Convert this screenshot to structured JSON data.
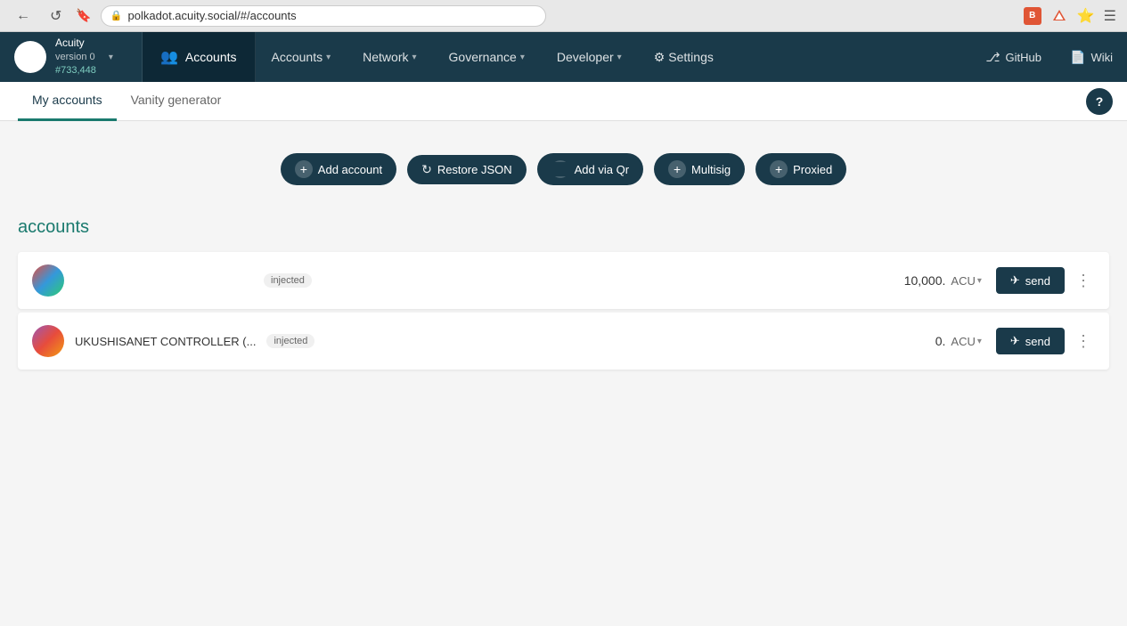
{
  "browser": {
    "url": "polkadot.acuity.social/#/accounts",
    "back_btn": "←",
    "reload_btn": "↺",
    "bookmark_icon": "🔖",
    "lock_icon": "🔒"
  },
  "app": {
    "logo": {
      "name": "Acuity",
      "version": "version 0",
      "block": "#733,448",
      "dropdown_label": "▾"
    },
    "active_tab": {
      "label": "Accounts",
      "icon": "👥"
    },
    "nav_items": [
      {
        "label": "Accounts",
        "has_dropdown": true
      },
      {
        "label": "Network",
        "has_dropdown": true
      },
      {
        "label": "Governance",
        "has_dropdown": true
      },
      {
        "label": "Developer",
        "has_dropdown": true
      },
      {
        "label": "Settings",
        "icon": "⚙",
        "has_dropdown": false
      }
    ],
    "nav_right": [
      {
        "label": "GitHub",
        "icon": "⎇"
      },
      {
        "label": "Wiki",
        "icon": "📄"
      }
    ]
  },
  "sub_tabs": [
    {
      "label": "My accounts",
      "active": true
    },
    {
      "label": "Vanity generator",
      "active": false
    }
  ],
  "help": "?",
  "action_buttons": [
    {
      "label": "Add account",
      "type": "plus"
    },
    {
      "label": "Restore JSON",
      "type": "restore"
    },
    {
      "label": "Add via Qr",
      "type": "grid"
    },
    {
      "label": "Multisig",
      "type": "plus"
    },
    {
      "label": "Proxied",
      "type": "plus"
    }
  ],
  "accounts_section": {
    "title": "accounts",
    "accounts": [
      {
        "name": "",
        "badge": "injected",
        "balance": "10,000.",
        "currency": "ACU",
        "send_label": "send"
      },
      {
        "name": "UKUSHISANET CONTROLLER (...",
        "badge": "injected",
        "balance": "0.",
        "currency": "ACU",
        "send_label": "send"
      }
    ]
  }
}
